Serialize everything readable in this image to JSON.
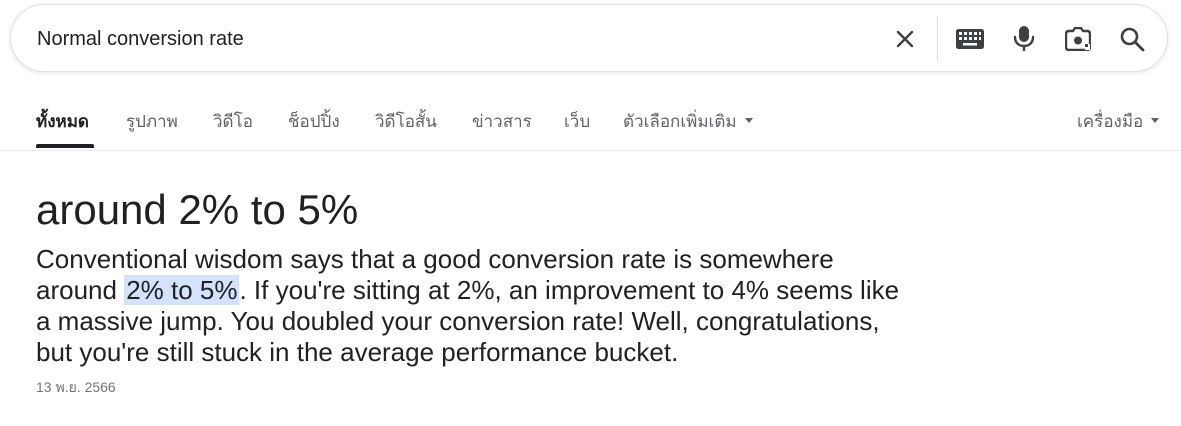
{
  "search": {
    "query": "Normal conversion rate"
  },
  "tabs": {
    "all": "ทั้งหมด",
    "images": "รูปภาพ",
    "videos": "วิดีโอ",
    "shopping": "ช็อปปิ้ง",
    "short_videos": "วิดีโอสั้น",
    "news": "ข่าวสาร",
    "web": "เว็บ",
    "more": "ตัวเลือกเพิ่มเติม",
    "tools": "เครื่องมือ"
  },
  "answer": {
    "title": "around 2% to 5%",
    "body_before": "Conventional wisdom says that a good conversion rate is somewhere around ",
    "body_highlight": "2% to 5%",
    "body_after": ". If you're sitting at 2%, an improvement to 4% seems like a massive jump. You doubled your conversion rate! Well, congratulations, but you're still stuck in the average performance bucket.",
    "date": "13 พ.ย. 2566"
  },
  "icons": {
    "clear": "close-icon",
    "keyboard": "keyboard-icon",
    "voice": "microphone-icon",
    "lens": "camera-lens-icon",
    "search": "search-icon"
  },
  "colors": {
    "text": "#202124",
    "muted": "#5f6368",
    "highlight": "#d3e3fd",
    "lens_accent": "#202124"
  }
}
